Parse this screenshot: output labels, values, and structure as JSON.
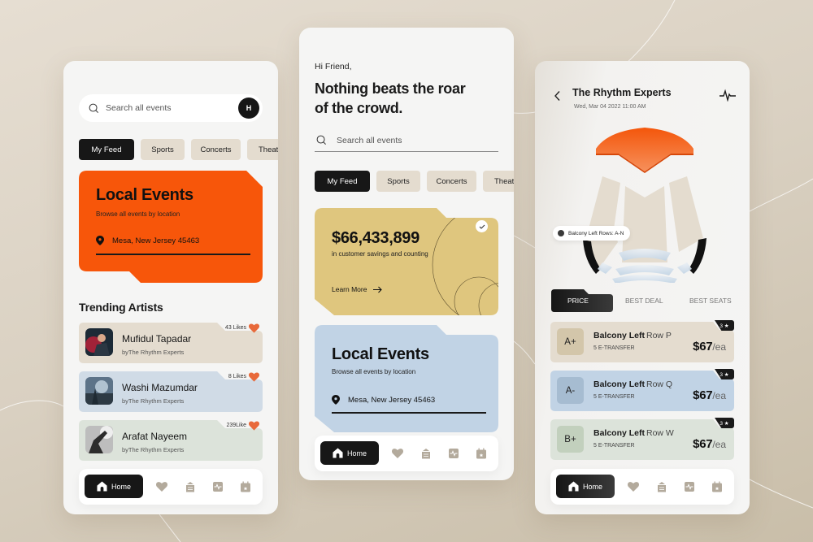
{
  "colors": {
    "background": "#ddd4c6",
    "phone_bg": "#f5f5f4",
    "orange": "#f7560a",
    "gold": "#dfc67e",
    "blue": "#c1d3e5",
    "beige": "#e4dccf",
    "sage": "#dce3da",
    "dark": "#171717",
    "heart": "#e8693a",
    "nav_icon": "#b3aa9c"
  },
  "phone1": {
    "search": {
      "placeholder": "Search all events",
      "avatar_initial": "H"
    },
    "chips": [
      {
        "label": "My Feed",
        "active": true
      },
      {
        "label": "Sports",
        "active": false
      },
      {
        "label": "Concerts",
        "active": false
      },
      {
        "label": "Theater",
        "active": false
      }
    ],
    "local_card": {
      "title": "Local Events",
      "subtitle": "Browse all events by location",
      "location": "Mesa, New Jersey 45463"
    },
    "trending_title": "Trending Artists",
    "artists": [
      {
        "name": "Mufidul Tapadar",
        "by": "byThe Rhythm Experts",
        "likes": "43 Likes",
        "color": "#e4dccf"
      },
      {
        "name": "Washi Mazumdar",
        "by": "byThe Rhythm Experts",
        "likes": "8 Likes",
        "color": "#d0dbe6"
      },
      {
        "name": "Arafat Nayeem",
        "by": "byThe Rhythm Experts",
        "likes": "239Like",
        "color": "#dce3da"
      }
    ],
    "nav": {
      "home_label": "Home",
      "icons": [
        "heart-icon",
        "ticket-icon",
        "activity-icon",
        "calendar-icon"
      ]
    }
  },
  "phone2": {
    "greeting": "Hi Friend,",
    "headline_line1": "Nothing beats the roar",
    "headline_line2": "of the crowd.",
    "search": {
      "placeholder": "Search all events"
    },
    "chips": [
      {
        "label": "My Feed",
        "active": true
      },
      {
        "label": "Sports",
        "active": false
      },
      {
        "label": "Concerts",
        "active": false
      },
      {
        "label": "Theater",
        "active": false
      }
    ],
    "savings_card": {
      "amount": "$66,433,899",
      "subtitle": "in customer savings and counting",
      "cta": "Learn More"
    },
    "local_card": {
      "title": "Local Events",
      "subtitle": "Browse all events by location",
      "location": "Mesa, New Jersey 45463"
    },
    "nav": {
      "home_label": "Home"
    }
  },
  "phone3": {
    "title": "The Rhythm Experts",
    "date": "Wed, Mar 04 2022  11:00 AM",
    "seat_tooltip": "Balcony Left  Rows: A-N",
    "sort_tabs": [
      {
        "label": "PRICE",
        "active": true
      },
      {
        "label": "BEST DEAL",
        "active": false
      },
      {
        "label": "BEST SEATS",
        "active": false
      }
    ],
    "tickets": [
      {
        "grade": "A+",
        "section": "Balcony Left",
        "row": "Row P",
        "transfer": "5 E-TRANSFER",
        "price": "$67",
        "unit": "/ea",
        "rating": "3 ★",
        "color": "#e4dccf",
        "grade_color": "#d3c6aa"
      },
      {
        "grade": "A-",
        "section": "Balcony Left",
        "row": "Row Q",
        "transfer": "5 E-TRANSFER",
        "price": "$67",
        "unit": "/ea",
        "rating": "3 ★",
        "color": "#c1d3e5",
        "grade_color": "#a6bcd1"
      },
      {
        "grade": "B+",
        "section": "Balcony Left",
        "row": "Row W",
        "transfer": "5 E-TRANSFER",
        "price": "$67",
        "unit": "/ea",
        "rating": "3 ★",
        "color": "#dce3da",
        "grade_color": "#c2d0bd"
      }
    ],
    "nav": {
      "home_label": "Home"
    }
  }
}
